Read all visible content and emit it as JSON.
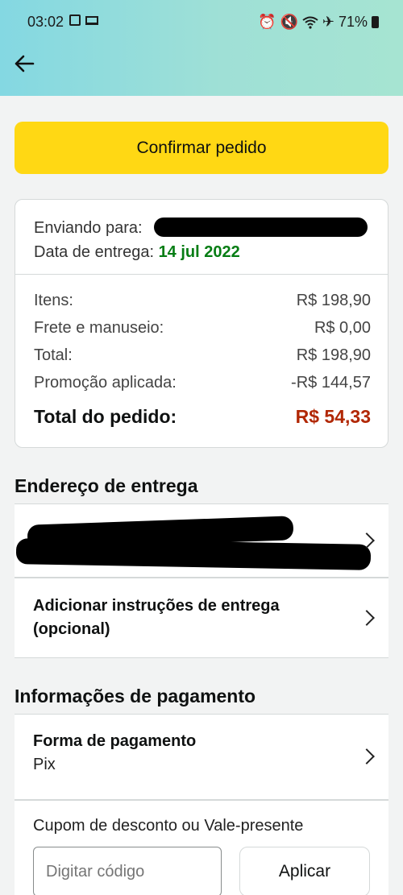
{
  "status_bar": {
    "time": "03:02",
    "battery": "71%"
  },
  "header": {
    "back_icon": "arrow-left-icon"
  },
  "actions": {
    "confirm_label": "Confirmar pedido"
  },
  "summary": {
    "shipping_to_label": "Enviando para:",
    "delivery_date_label": "Data de entrega:",
    "delivery_date": "14 jul 2022",
    "rows": [
      {
        "label": "Itens:",
        "value": "R$ 198,90"
      },
      {
        "label": "Frete e manuseio:",
        "value": "R$ 0,00"
      },
      {
        "label": "Total:",
        "value": "R$ 198,90"
      },
      {
        "label": "Promoção aplicada:",
        "value": "-R$ 144,57"
      }
    ],
    "order_total_label": "Total do pedido:",
    "order_total_value": "R$ 54,33",
    "order_total_color": "#b12704",
    "delivery_date_color": "#067d14"
  },
  "delivery": {
    "section_title": "Endereço de entrega",
    "instructions_title": "Adicionar instruções de entrega (opcional)"
  },
  "payment": {
    "section_title": "Informações de pagamento",
    "method_title": "Forma de pagamento",
    "method_value": "Pix",
    "coupon_label": "Cupom de desconto ou Vale-presente",
    "coupon_placeholder": "Digitar código",
    "apply_label": "Aplicar"
  },
  "colors": {
    "confirm_button": "#ffd814",
    "background": "#f2f3f3"
  }
}
